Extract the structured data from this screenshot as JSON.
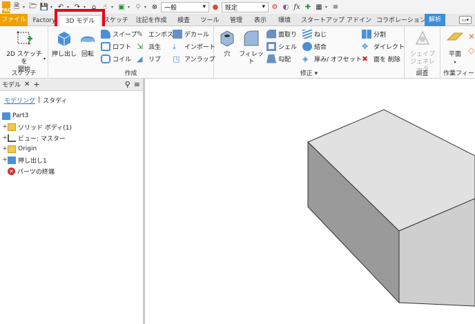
{
  "qat": {
    "style_combo": "一般",
    "material_combo": "既定",
    "logo_text": "PRO"
  },
  "tabs": [
    {
      "label": "ファイル"
    },
    {
      "label": "Factory"
    },
    {
      "label": "3D モデル"
    },
    {
      "label": "スケッチ"
    },
    {
      "label": "注記を作成"
    },
    {
      "label": "検査"
    },
    {
      "label": "ツール"
    },
    {
      "label": "管理"
    },
    {
      "label": "表示"
    },
    {
      "label": "環境"
    },
    {
      "label": "スタートアップ"
    },
    {
      "label": "アドイン"
    },
    {
      "label": "コラボレーション"
    },
    {
      "label": "解析"
    }
  ],
  "ribbon": {
    "sketch": {
      "label": "スケッチ",
      "start_sketch_line1": "2D スケッチを",
      "start_sketch_line2": "開始"
    },
    "create": {
      "label": "作成",
      "extrude": "押し出し",
      "revolve": "回転",
      "sweep": "スイープ",
      "loft": "ロフト",
      "coil": "コイル",
      "emboss": "エンボス",
      "derive": "派生",
      "rib": "リブ",
      "decal": "デカール",
      "import": "インポート",
      "unwrap": "アンラップ"
    },
    "modify": {
      "label": "修正",
      "hole": "穴",
      "fillet": "フィレット",
      "chamfer": "面取り",
      "shell": "シェル",
      "draft": "勾配",
      "thread": "ねじ",
      "combine": "結合",
      "thicken": "厚み/ オフセット",
      "split": "分割",
      "direct": "ダイレクト",
      "delete_face": "面を 削除"
    },
    "explore": {
      "label": "調査",
      "shape_gen_line1": "シェイプ",
      "shape_gen_line2": "ジェネレータ"
    },
    "work_features": {
      "label": "作業フィー",
      "plane": "平面"
    }
  },
  "browser": {
    "tab_label": "モデル",
    "modeling": "モデリング",
    "separator": "|",
    "study": "スタディ",
    "nodes": [
      {
        "label": "Part3"
      },
      {
        "label": "ソリッド ボディ(1)"
      },
      {
        "label": "ビュー: マスター"
      },
      {
        "label": "Origin"
      },
      {
        "label": "押し出し1"
      },
      {
        "label": "パーツの終端"
      }
    ]
  },
  "colors": {
    "file_tab": "#f0a000",
    "analysis_tab": "#3b8ed8",
    "highlight": "#e8001a",
    "link": "#2a6fc0"
  }
}
